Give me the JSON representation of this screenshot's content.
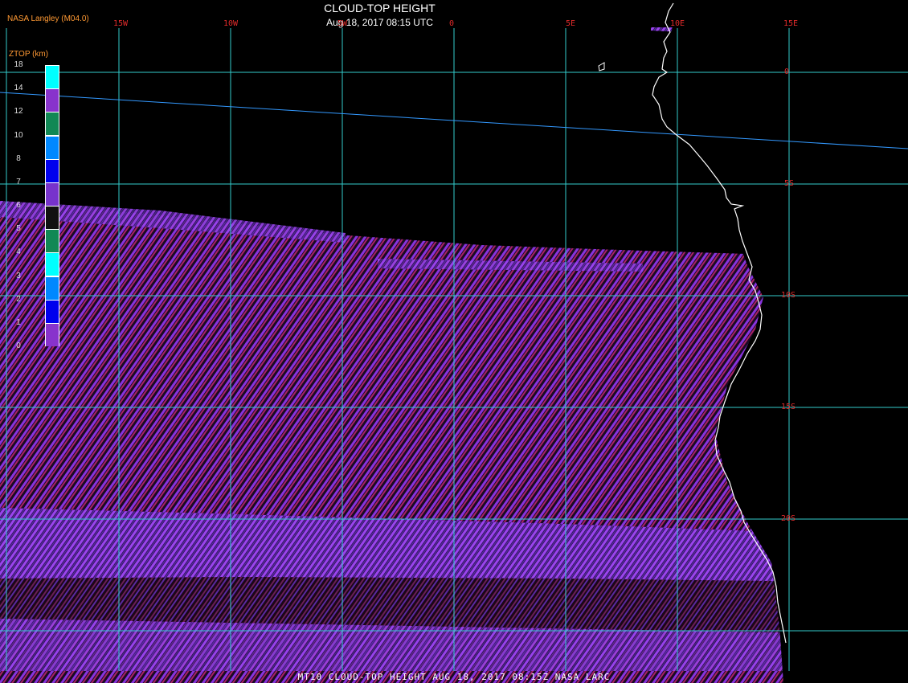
{
  "header": {
    "title": "CLOUD-TOP HEIGHT",
    "subtitle": "Aug 18, 2017 08:15 UTC",
    "source": "NASA Langley (M04.0)"
  },
  "legend": {
    "title": "ZTOP (km)",
    "labels": [
      "18",
      "14",
      "12",
      "10",
      "8",
      "7",
      "6",
      "5",
      "4",
      "3",
      "2",
      "1",
      "0"
    ],
    "colors": [
      "#00ffff",
      "#8833cc",
      "#118855",
      "#0088ff",
      "#0000ee",
      "#7733cc",
      "#111111",
      "#118855",
      "#00ffff",
      "#0088ff",
      "#0000ee",
      "#8833cc"
    ]
  },
  "grid": {
    "lon_labels": [
      "15W",
      "10W",
      "5W",
      "0",
      "5E",
      "10E",
      "15E"
    ],
    "lat_labels": [
      "0",
      "5S",
      "10S",
      "15S",
      "20S"
    ]
  },
  "footer": {
    "banner": "MT10  CLOUD-TOP HEIGHT   AUG 18, 2017 08:15Z   NASA LARC"
  },
  "colors": {
    "gridline": "#33cccc",
    "coastline": "#ffffff",
    "cloud_purple": "#8833dd",
    "cloud_magenta": "#aa2266",
    "grid_label": "#e02a2a",
    "source_label": "#ff9933"
  }
}
